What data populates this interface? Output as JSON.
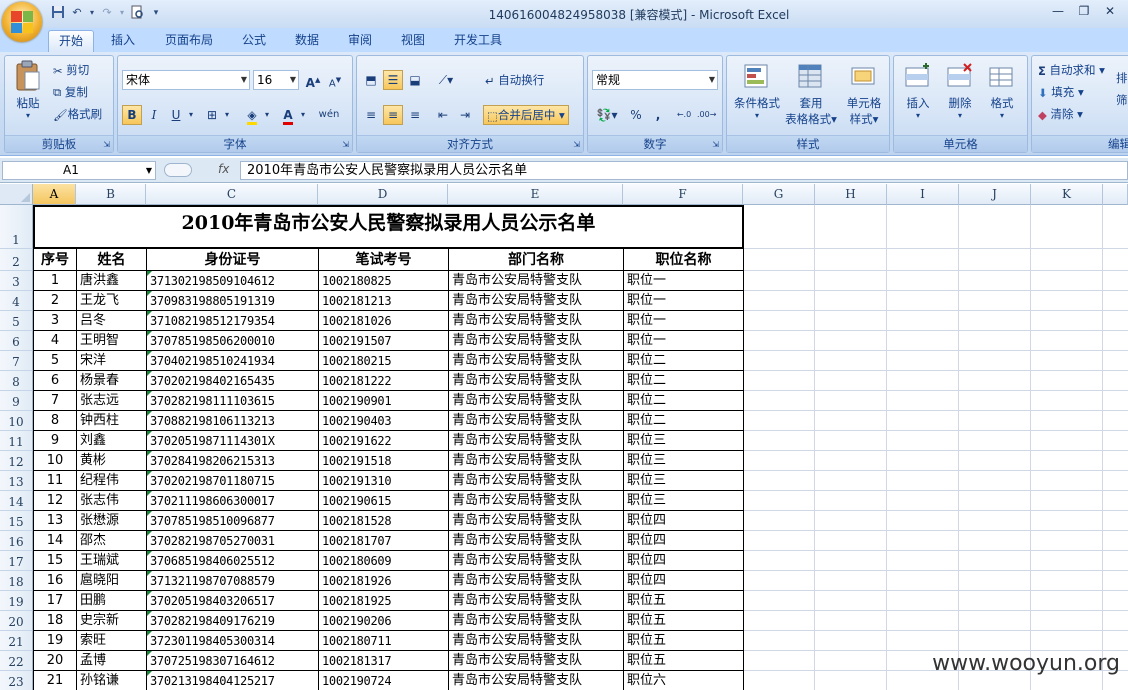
{
  "window": {
    "title": "140616004824958038  [兼容模式] - Microsoft Excel",
    "qat_icons": [
      "save-icon",
      "undo-icon",
      "redo-icon",
      "print-preview-icon",
      "customize-icon"
    ]
  },
  "ribbon_tabs": [
    "开始",
    "插入",
    "页面布局",
    "公式",
    "数据",
    "审阅",
    "视图",
    "开发工具"
  ],
  "ribbon": {
    "clipboard": {
      "label": "剪贴板",
      "paste": "粘贴",
      "cut": "剪切",
      "copy": "复制",
      "format_painter": "格式刷"
    },
    "font": {
      "label": "字体",
      "font_name": "宋体",
      "font_size": "16",
      "grow": "A",
      "shrink": "A",
      "bold": "B",
      "italic": "I",
      "underline": "U",
      "wen": "wén"
    },
    "alignment": {
      "label": "对齐方式",
      "wrap": "自动换行",
      "merge": "合并后居中"
    },
    "number": {
      "label": "数字",
      "format": "常规",
      "percent": "%",
      "comma": ","
    },
    "styles": {
      "label": "样式",
      "conditional": "条件格式",
      "table_line1": "套用",
      "table_line2": "表格格式",
      "cell_line1": "单元格",
      "cell_line2": "样式"
    },
    "cells": {
      "label": "单元格",
      "insert": "插入",
      "delete": "删除",
      "format": "格式"
    },
    "editing": {
      "label": "编辑",
      "autosum": "自动求和",
      "fill": "填充",
      "clear": "清除",
      "sort_partial": "排",
      "find_partial": "筛"
    }
  },
  "formula_bar": {
    "name_box": "A1",
    "fx": "fx",
    "content": "2010年青岛市公安人民警察拟录用人员公示名单"
  },
  "columns": [
    "A",
    "B",
    "C",
    "D",
    "E",
    "F",
    "G",
    "H",
    "I",
    "J",
    "K"
  ],
  "rows": [
    "1",
    "2",
    "3",
    "4",
    "5",
    "6",
    "7",
    "8",
    "9",
    "10",
    "11",
    "12",
    "13",
    "14",
    "15",
    "16",
    "17",
    "18",
    "19",
    "20",
    "21",
    "22",
    "23"
  ],
  "sheet": {
    "title": "2010年青岛市公安人民警察拟录用人员公示名单",
    "headers": [
      "序号",
      "姓名",
      "身份证号",
      "笔试考号",
      "部门名称",
      "职位名称"
    ],
    "records": [
      [
        "1",
        "唐洪鑫",
        "371302198509104612",
        "1002180825",
        "青岛市公安局特警支队",
        "职位一"
      ],
      [
        "2",
        "王龙飞",
        "370983198805191319",
        "1002181213",
        "青岛市公安局特警支队",
        "职位一"
      ],
      [
        "3",
        "吕冬",
        "371082198512179354",
        "1002181026",
        "青岛市公安局特警支队",
        "职位一"
      ],
      [
        "4",
        "王明智",
        "370785198506200010",
        "1002191507",
        "青岛市公安局特警支队",
        "职位一"
      ],
      [
        "5",
        "宋洋",
        "370402198510241934",
        "1002180215",
        "青岛市公安局特警支队",
        "职位二"
      ],
      [
        "6",
        "杨景春",
        "370202198402165435",
        "1002181222",
        "青岛市公安局特警支队",
        "职位二"
      ],
      [
        "7",
        "张志远",
        "370282198111103615",
        "1002190901",
        "青岛市公安局特警支队",
        "职位二"
      ],
      [
        "8",
        "钟西柱",
        "370882198106113213",
        "1002190403",
        "青岛市公安局特警支队",
        "职位二"
      ],
      [
        "9",
        "刘鑫",
        "37020519871114301X",
        "1002191622",
        "青岛市公安局特警支队",
        "职位三"
      ],
      [
        "10",
        "黄彬",
        "370284198206215313",
        "1002191518",
        "青岛市公安局特警支队",
        "职位三"
      ],
      [
        "11",
        "纪程伟",
        "370202198701180715",
        "1002191310",
        "青岛市公安局特警支队",
        "职位三"
      ],
      [
        "12",
        "张志伟",
        "370211198606300017",
        "1002190615",
        "青岛市公安局特警支队",
        "职位三"
      ],
      [
        "13",
        "张懋源",
        "370785198510096877",
        "1002181528",
        "青岛市公安局特警支队",
        "职位四"
      ],
      [
        "14",
        "邵杰",
        "370282198705270031",
        "1002181707",
        "青岛市公安局特警支队",
        "职位四"
      ],
      [
        "15",
        "王瑞斌",
        "370685198406025512",
        "1002180609",
        "青岛市公安局特警支队",
        "职位四"
      ],
      [
        "16",
        "扈晓阳",
        "371321198707088579",
        "1002181926",
        "青岛市公安局特警支队",
        "职位四"
      ],
      [
        "17",
        "田鹏",
        "370205198403206517",
        "1002181925",
        "青岛市公安局特警支队",
        "职位五"
      ],
      [
        "18",
        "史宗新",
        "370282198409176219",
        "1002190206",
        "青岛市公安局特警支队",
        "职位五"
      ],
      [
        "19",
        "索旺",
        "372301198405300314",
        "1002180711",
        "青岛市公安局特警支队",
        "职位五"
      ],
      [
        "20",
        "孟博",
        "370725198307164612",
        "1002181317",
        "青岛市公安局特警支队",
        "职位五"
      ],
      [
        "21",
        "孙铭谦",
        "370213198404125217",
        "1002190724",
        "青岛市公安局特警支队",
        "职位六"
      ]
    ]
  },
  "watermark": "www.wooyun.org",
  "colors": {
    "ribbon_bg": "#c6daf3",
    "tab_text": "#15428b",
    "header_sel": "#f5c660",
    "gridline": "#d0d7e5"
  }
}
